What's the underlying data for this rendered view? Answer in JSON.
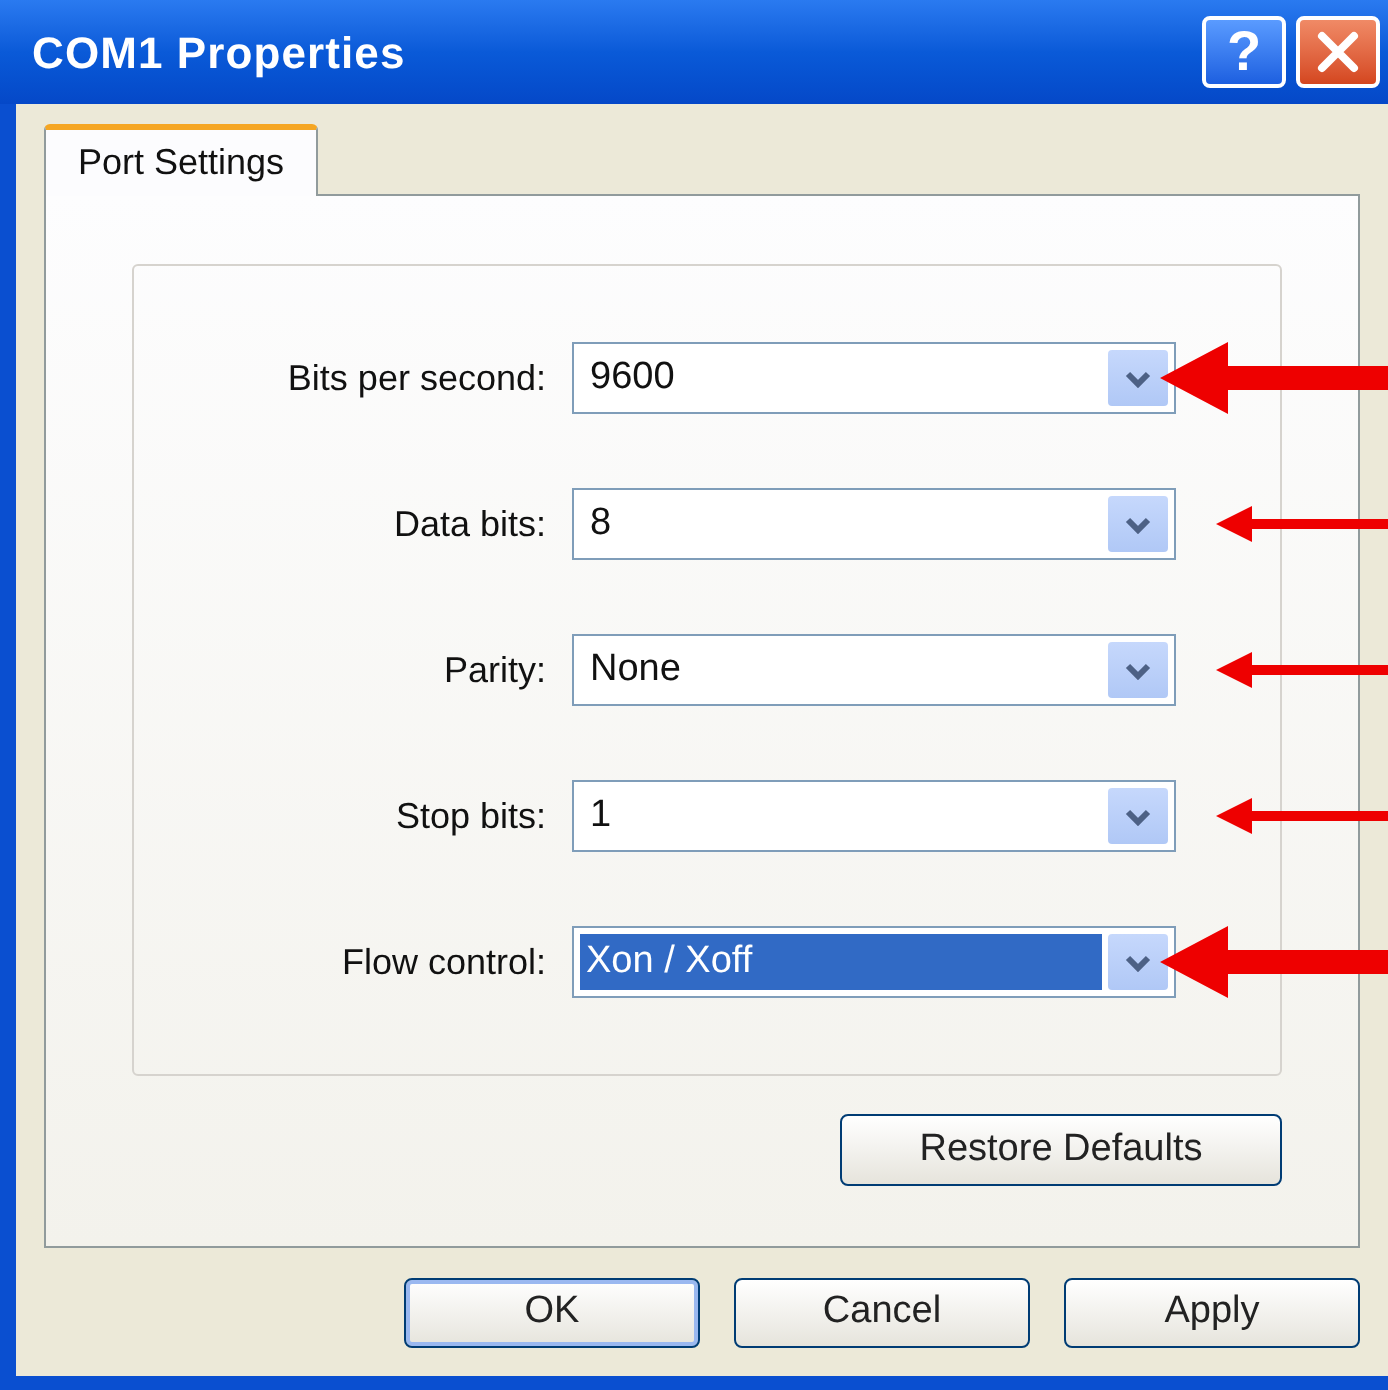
{
  "window": {
    "title": "COM1 Properties",
    "title_buttons": [
      {
        "kind": "help",
        "label": "?"
      },
      {
        "kind": "close"
      }
    ]
  },
  "tabs": [
    {
      "label": "Port Settings",
      "selected": true
    }
  ],
  "fields": [
    {
      "label": "Bits per second:",
      "value": "9600",
      "selected": false,
      "kind": "thick"
    },
    {
      "label": "Data bits:",
      "value": "8",
      "selected": false,
      "kind": "thin"
    },
    {
      "label": "Parity:",
      "value": "None",
      "selected": false,
      "kind": "thin"
    },
    {
      "label": "Stop bits:",
      "value": "1",
      "selected": false,
      "kind": "thin"
    },
    {
      "label": "Flow control:",
      "value": "Xon / Xoff",
      "selected": true,
      "kind": "thick"
    }
  ],
  "panel_button": "Restore Defaults",
  "buttons": [
    {
      "label": "OK",
      "default": true
    },
    {
      "label": "Cancel",
      "default": false
    },
    {
      "label": "Apply",
      "default": false
    }
  ]
}
